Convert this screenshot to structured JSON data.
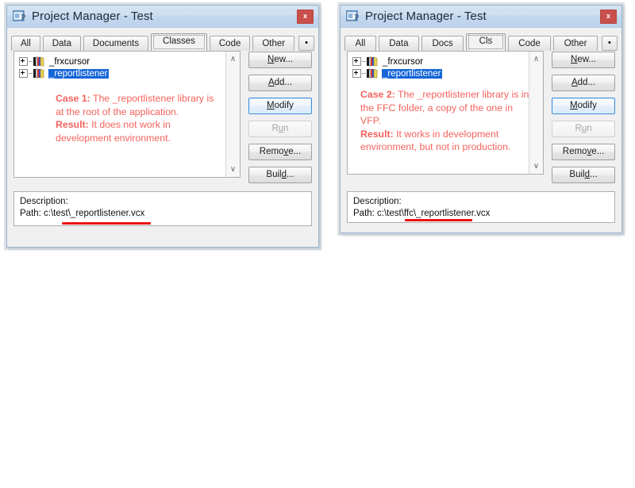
{
  "windows": [
    {
      "id": "left",
      "title": "Project Manager - Test",
      "icon": "project-manager-icon",
      "close_label": "x",
      "tabs": [
        {
          "label": "All",
          "selected": false
        },
        {
          "label": "Data",
          "selected": false
        },
        {
          "label": "Documents",
          "selected": false
        },
        {
          "label": "Classes",
          "selected": true
        },
        {
          "label": "Code",
          "selected": false
        },
        {
          "label": "Other",
          "selected": false
        }
      ],
      "tab_more_label": "•",
      "tree": [
        {
          "label": "_frxcursor",
          "selected": false,
          "expandable": true
        },
        {
          "label": "_reportlistener",
          "selected": true,
          "expandable": true
        }
      ],
      "note": {
        "line1_bold": "Case 1:",
        "line1_rest": " The _reportlistener library is at the root of the application.",
        "line2_bold": "Result:",
        "line2_rest": " It does not work in development environment."
      },
      "buttons": [
        {
          "label": "New...",
          "accel": "N",
          "state": "normal"
        },
        {
          "label": "Add...",
          "accel": "A",
          "state": "normal"
        },
        {
          "label": "Modify",
          "accel": "M",
          "state": "default"
        },
        {
          "label": "Run",
          "accel": "u",
          "state": "disabled"
        },
        {
          "label": "Remove...",
          "accel": "v",
          "state": "normal"
        },
        {
          "label": "Build...",
          "accel": "d",
          "state": "normal"
        }
      ],
      "description": {
        "label": "Description:",
        "path": "Path: c:\\test\\_reportlistener.vcx"
      }
    },
    {
      "id": "right",
      "title": "Project Manager - Test",
      "icon": "project-manager-icon",
      "close_label": "x",
      "tabs": [
        {
          "label": "All",
          "selected": false
        },
        {
          "label": "Data",
          "selected": false
        },
        {
          "label": "Docs",
          "selected": false
        },
        {
          "label": "Cls",
          "selected": true
        },
        {
          "label": "Code",
          "selected": false
        },
        {
          "label": "Other",
          "selected": false
        }
      ],
      "tab_more_label": "•",
      "tree": [
        {
          "label": "_frxcursor",
          "selected": false,
          "expandable": true
        },
        {
          "label": "_reportlistener",
          "selected": true,
          "expandable": true
        }
      ],
      "note": {
        "line1_bold": "Case 2:",
        "line1_rest": " The _reportlistener library is in the FFC folder, a copy of the one in VFP.",
        "line2_bold": "Result:",
        "line2_rest": " It works in development environment, but not in production."
      },
      "buttons": [
        {
          "label": "New...",
          "accel": "N",
          "state": "normal"
        },
        {
          "label": "Add...",
          "accel": "A",
          "state": "normal"
        },
        {
          "label": "Modify",
          "accel": "M",
          "state": "default"
        },
        {
          "label": "Run",
          "accel": "u",
          "state": "disabled"
        },
        {
          "label": "Remove...",
          "accel": "v",
          "state": "normal"
        },
        {
          "label": "Build...",
          "accel": "d",
          "state": "normal"
        }
      ],
      "description": {
        "label": "Description:",
        "path": "Path: c:\\test\\ffc\\_reportlistener.vcx"
      }
    }
  ],
  "scrollbar": {
    "up_glyph": "∧",
    "down_glyph": "∨"
  },
  "colors": {
    "titlebar": "#c4d8ee",
    "close_button": "#c9504b",
    "selection": "#1565d8",
    "annotation_red": "#f4625c",
    "underline_red": "#e8110f",
    "default_button_border": "#3c8fde"
  }
}
